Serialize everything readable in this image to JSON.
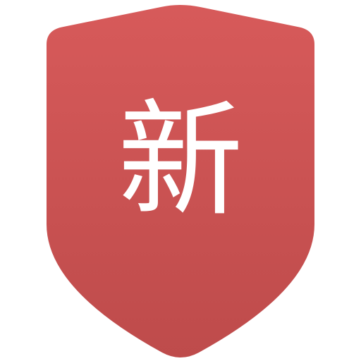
{
  "badge": {
    "character": "新",
    "colors": {
      "shield_top": "#D75A5A",
      "shield_bottom": "#BE4B4B",
      "glyph": "#FFFFFF",
      "background": "#FFFFFF"
    }
  }
}
